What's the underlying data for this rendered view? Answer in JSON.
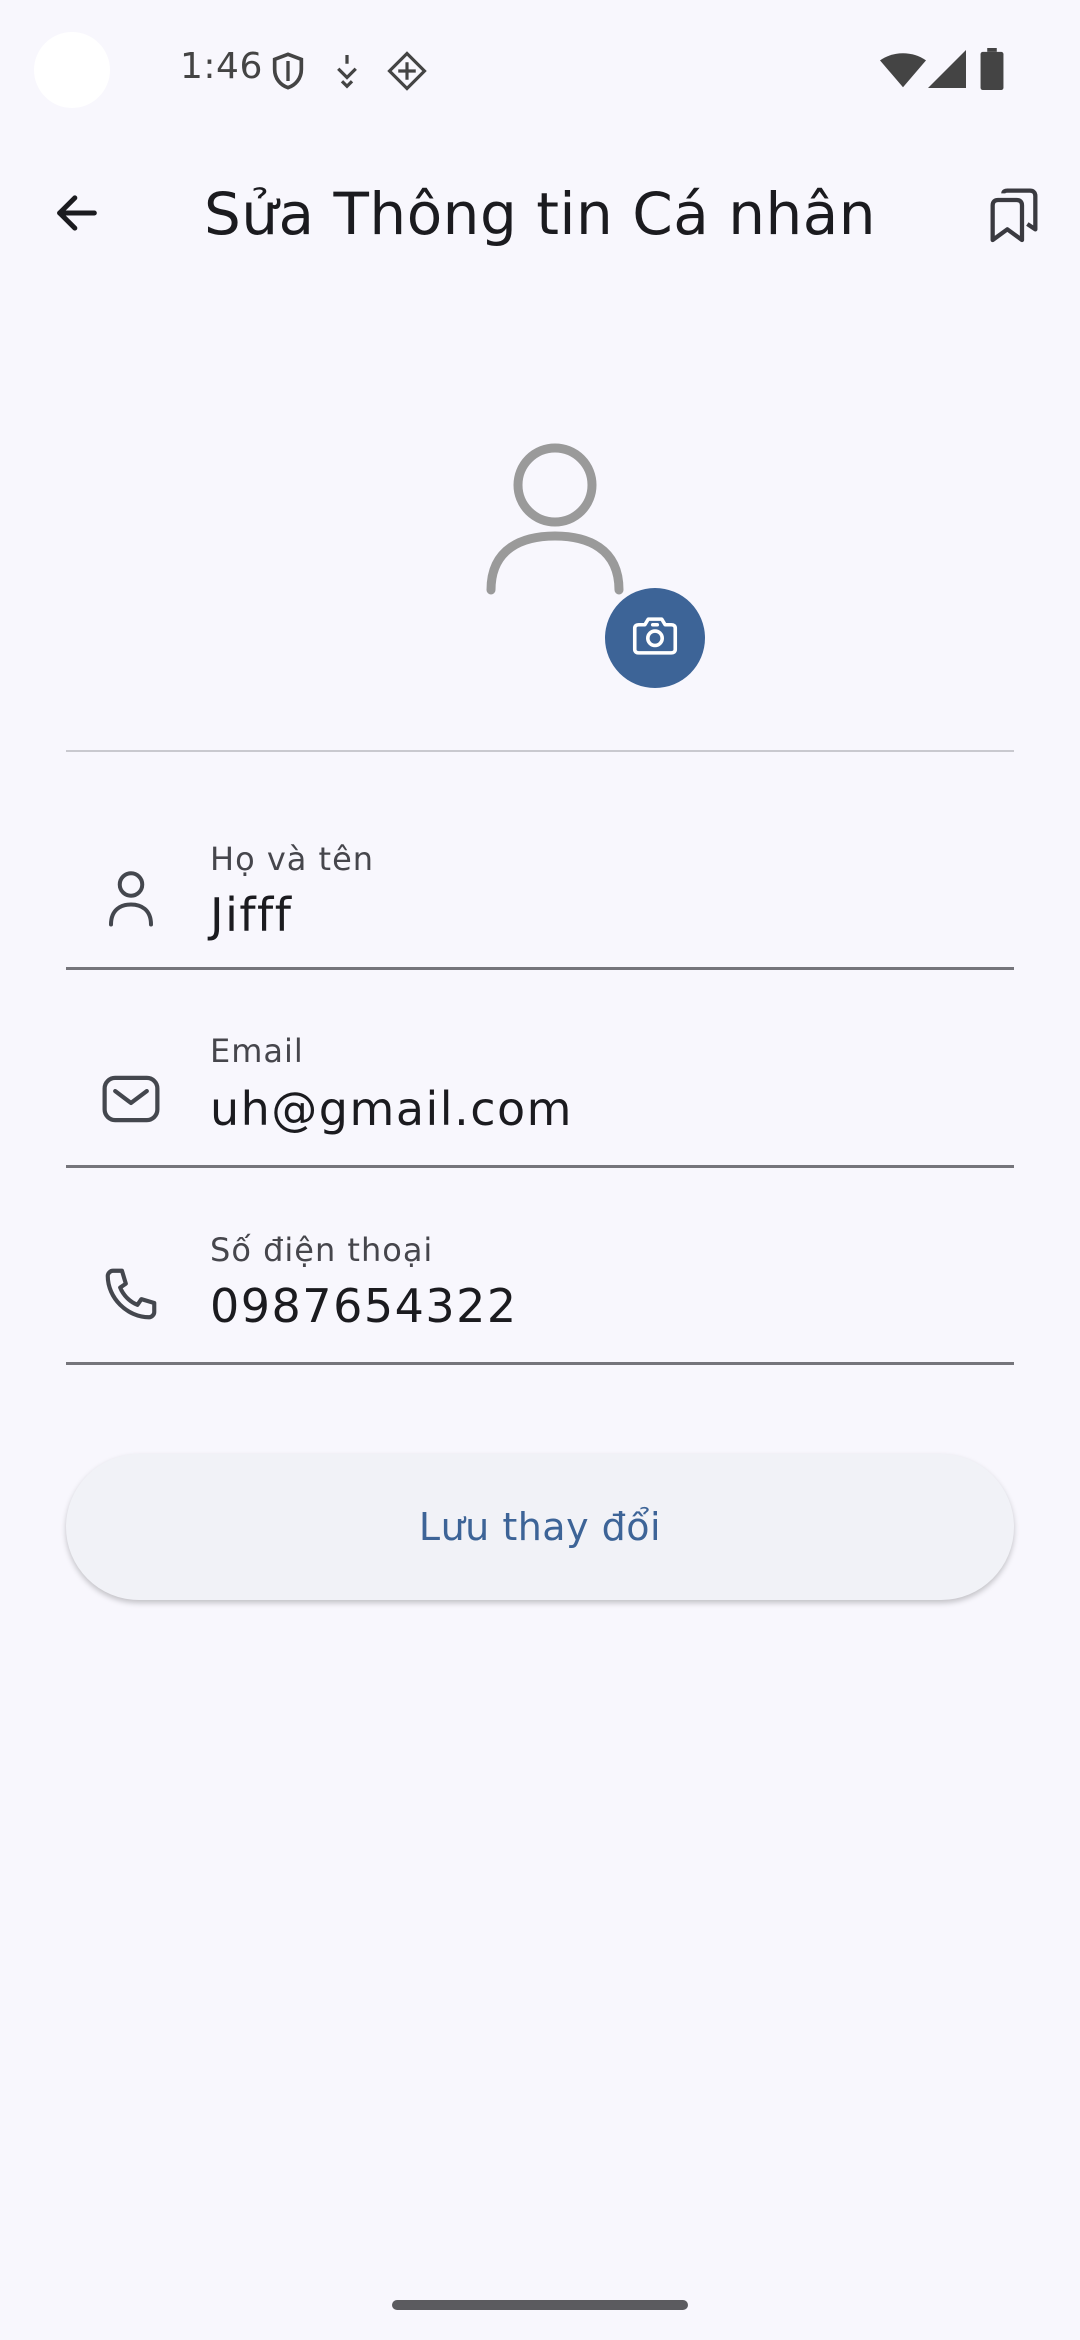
{
  "status_bar": {
    "time": "1:46",
    "left_icons": [
      "shield-icon",
      "download-arrow-icon",
      "diamond-grid-icon"
    ],
    "right_icons": [
      "wifi-icon",
      "cellular-signal-icon",
      "battery-icon"
    ]
  },
  "app_bar": {
    "title": "Sửa Thông tin Cá nhân",
    "back_icon": "arrow-back-icon",
    "action_icon": "bookmarks-icon"
  },
  "avatar": {
    "placeholder_icon": "person-outline-icon",
    "camera_icon": "camera-icon",
    "camera_button_color": "#3d6497"
  },
  "form": {
    "fields": [
      {
        "icon": "person-icon",
        "label": "Họ và tên",
        "value": "Jifff"
      },
      {
        "icon": "mail-icon",
        "label": "Email",
        "value": "uh@gmail.com"
      },
      {
        "icon": "phone-icon",
        "label": "Số điện thoại",
        "value": "0987654322"
      }
    ],
    "save_label": "Lưu thay đổi"
  },
  "colors": {
    "accent": "#3d6497",
    "background": "#f8f7fd",
    "text": "#1b1b1f"
  }
}
